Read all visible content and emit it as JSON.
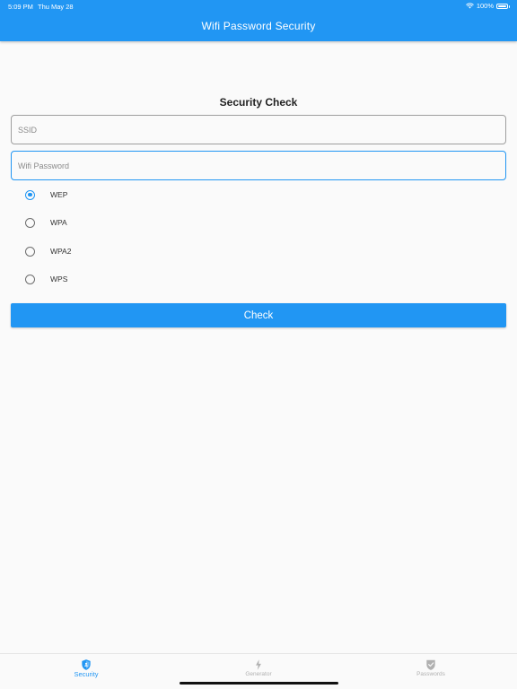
{
  "status_bar": {
    "time": "5:09 PM",
    "date": "Thu May 28",
    "battery": "100%"
  },
  "app_bar": {
    "title": "Wifi Password Security"
  },
  "form": {
    "title": "Security Check",
    "ssid": {
      "placeholder": "SSID",
      "value": ""
    },
    "password": {
      "placeholder": "Wifi Password",
      "value": ""
    },
    "security_options": [
      {
        "label": "WEP",
        "selected": true
      },
      {
        "label": "WPA",
        "selected": false
      },
      {
        "label": "WPA2",
        "selected": false
      },
      {
        "label": "WPS",
        "selected": false
      }
    ],
    "check_label": "Check"
  },
  "tab_bar": {
    "tabs": [
      {
        "label": "Security",
        "icon": "shield-icon",
        "active": true
      },
      {
        "label": "Generator",
        "icon": "bolt-icon",
        "active": false
      },
      {
        "label": "Passwords",
        "icon": "shield-check-icon",
        "active": false
      }
    ]
  },
  "colors": {
    "primary": "#2196f3",
    "background": "#fafafa",
    "inactive_tab": "#b0b0b0"
  }
}
